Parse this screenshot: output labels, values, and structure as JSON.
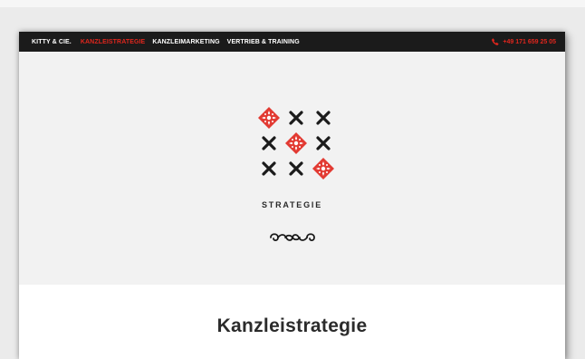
{
  "nav": {
    "items": [
      {
        "label": "KITTY & CIE.",
        "state": "brand"
      },
      {
        "label": "KANZLEISTRATEGIE",
        "state": "active"
      },
      {
        "label": "KANZLEIMARKETING",
        "state": "normal"
      },
      {
        "label": "VERTRIEB & TRAINING",
        "state": "normal"
      }
    ],
    "phone": "+49 171 659 25 05",
    "phone_icon": "phone-icon"
  },
  "hero": {
    "grid_pattern": [
      "ornament",
      "x",
      "x",
      "x",
      "ornament",
      "x",
      "x",
      "x",
      "ornament"
    ],
    "label": "STRATEGIE",
    "divider_icon": "flourish-divider-icon"
  },
  "content": {
    "title": "Kanzleistrategie"
  },
  "colors": {
    "accent": "#e0261d",
    "nav_bg": "#1b1b1b",
    "hero_bg": "#f2f2f2"
  }
}
